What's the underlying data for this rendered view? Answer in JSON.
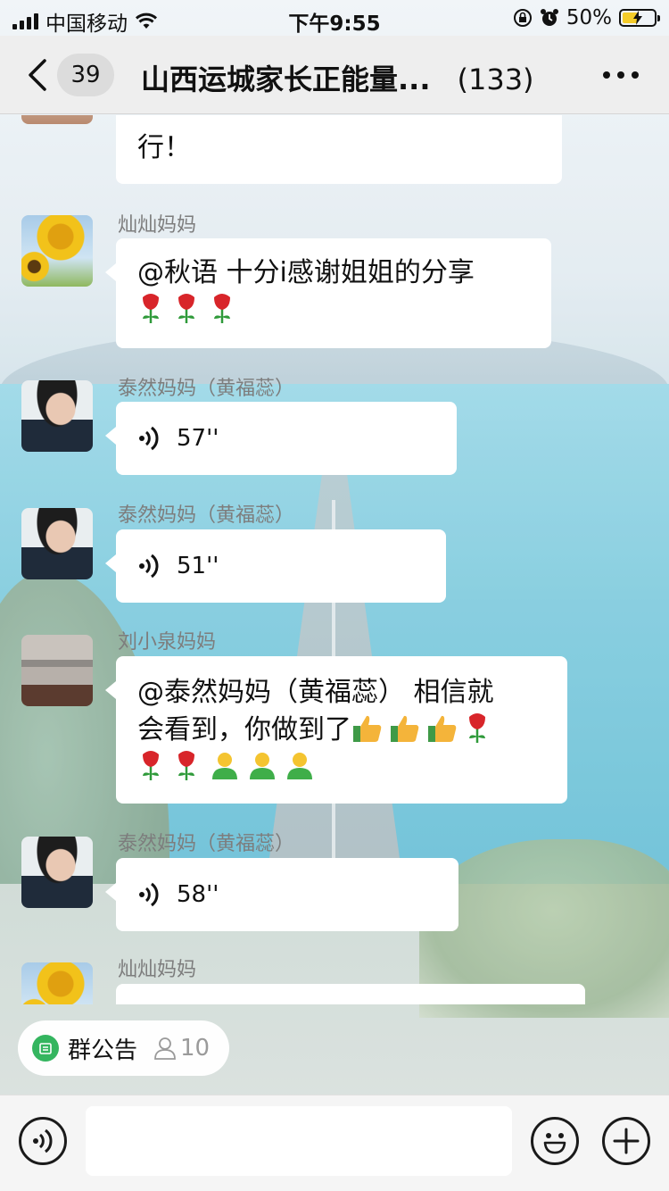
{
  "status_bar": {
    "carrier": "中国移动",
    "time": "下午9:55",
    "battery": "50%",
    "battery_level": 0.5
  },
  "nav": {
    "unread_count": "39",
    "title": "山西运城家长正能量...",
    "member_count": "(133)"
  },
  "messages": [
    {
      "type": "text",
      "partial": true,
      "text": "行！"
    },
    {
      "type": "text",
      "sender": "灿灿妈妈",
      "text": "@秋语 十分i感谢姐姐的分享",
      "emojis": [
        "rose-icon",
        "rose-icon",
        "rose-icon"
      ]
    },
    {
      "type": "voice",
      "sender": "泰然妈妈（黄福蕊）",
      "duration": "57''"
    },
    {
      "type": "voice",
      "sender": "泰然妈妈（黄福蕊）",
      "duration": "51''"
    },
    {
      "type": "text",
      "sender": "刘小泉妈妈",
      "line1": "@泰然妈妈（黄福蕊） 相信就",
      "line2": "会看到，你做到了"
    },
    {
      "type": "voice",
      "sender": "泰然妈妈（黄福蕊）",
      "duration": "58''"
    },
    {
      "type": "text",
      "sender": "灿灿妈妈",
      "partial": true
    }
  ],
  "notice": {
    "label": "群公告",
    "members": "10"
  },
  "input": {
    "placeholder": ""
  },
  "colors": {
    "bubble": "#ffffff",
    "navbar": "#ededed",
    "notice_icon": "#34b55f"
  }
}
